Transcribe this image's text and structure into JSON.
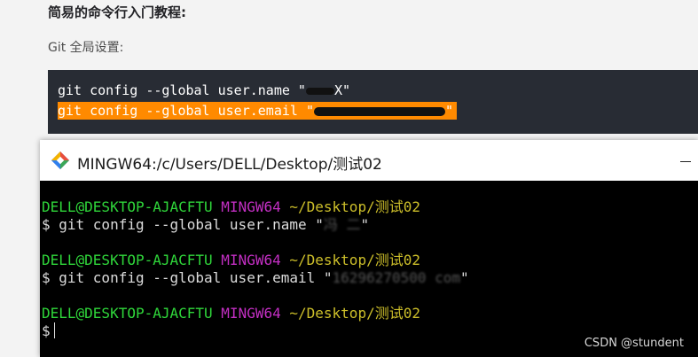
{
  "article": {
    "heading": "简易的命令行入门教程:",
    "subtext": "Git 全局设置:",
    "code": {
      "line1_prefix": "git config --global user.name \"",
      "line1_visible_end": "X\"",
      "line2_prefix": "git config --global user.email \"",
      "line2_end": "\""
    }
  },
  "window": {
    "title": "MINGW64:/c/Users/DELL/Desktop/测试02",
    "icon": "git-bash-icon"
  },
  "terminal": {
    "blocks": [
      {
        "user": "DELL@DESKTOP-AJACFTU",
        "shell": "MINGW64",
        "path": "~/Desktop/测试02",
        "command": "$ git config --global user.name \"",
        "masked": "冯 二",
        "command_end": "\""
      },
      {
        "user": "DELL@DESKTOP-AJACFTU",
        "shell": "MINGW64",
        "path": "~/Desktop/测试02",
        "command": "$ git config --global user.email \"",
        "masked": "16296270500 com",
        "command_end": "\""
      },
      {
        "user": "DELL@DESKTOP-AJACFTU",
        "shell": "MINGW64",
        "path": "~/Desktop/测试02",
        "prompt": "$"
      }
    ]
  },
  "watermark": "CSDN @stundent",
  "colors": {
    "green": "#2fd63a",
    "magenta": "#c32fc3",
    "yellow": "#cdbf2a",
    "highlight": "#ff8a00"
  }
}
